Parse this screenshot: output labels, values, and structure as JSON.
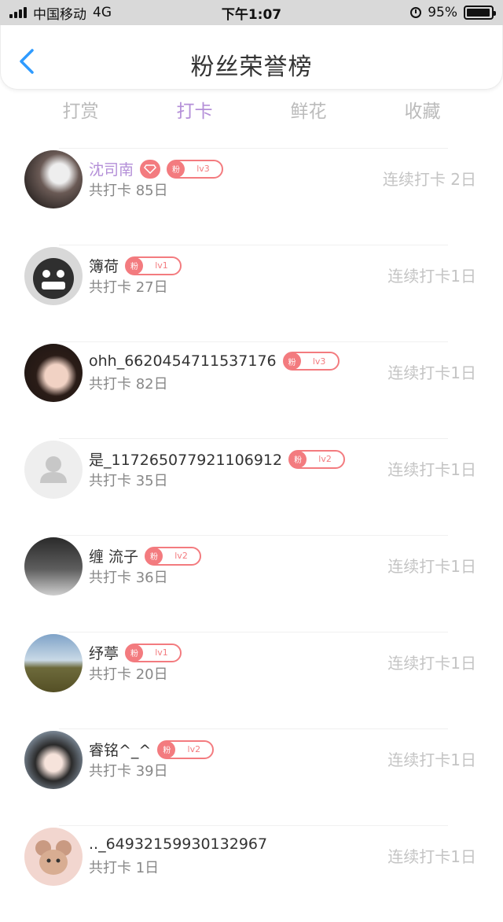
{
  "status_bar": {
    "carrier": "中国移动",
    "network": "4G",
    "time": "下午1:07",
    "battery_percent": "95%",
    "battery_level": 0.95
  },
  "nav": {
    "title": "粉丝荣誉榜",
    "back_icon": "chevron-left-icon"
  },
  "tabs": [
    {
      "label": "打赏",
      "active": false
    },
    {
      "label": "打卡",
      "active": true
    },
    {
      "label": "鲜花",
      "active": false
    },
    {
      "label": "收藏",
      "active": false
    }
  ],
  "colors": {
    "accent_purple": "#b48fd8",
    "badge_red": "#f37b7f",
    "muted_text": "#888888",
    "streak_text": "#c4c4c4"
  },
  "rows": [
    {
      "name": "沈司南",
      "vip": true,
      "badge_mark": "粉",
      "badge_level": "lv3",
      "total": "共打卡 85日",
      "streak": "连续打卡 2日"
    },
    {
      "name": "簿荷",
      "vip": false,
      "badge_mark": "粉",
      "badge_level": "lv1",
      "total": "共打卡 27日",
      "streak": "连续打卡1日"
    },
    {
      "name": "ohh_6620454711537176",
      "vip": false,
      "badge_mark": "粉",
      "badge_level": "lv3",
      "total": "共打卡 82日",
      "streak": "连续打卡1日"
    },
    {
      "name": "是_117265077921106912",
      "vip": false,
      "badge_mark": "粉",
      "badge_level": "lv2",
      "total": "共打卡 35日",
      "streak": "连续打卡1日"
    },
    {
      "name": "缠 流子",
      "vip": false,
      "badge_mark": "粉",
      "badge_level": "lv2",
      "total": "共打卡 36日",
      "streak": "连续打卡1日"
    },
    {
      "name": "纾葶",
      "vip": false,
      "badge_mark": "粉",
      "badge_level": "lv1",
      "total": "共打卡 20日",
      "streak": "连续打卡1日"
    },
    {
      "name": "睿铭^_^",
      "vip": false,
      "badge_mark": "粉",
      "badge_level": "lv2",
      "total": "共打卡 39日",
      "streak": "连续打卡1日"
    },
    {
      "name": ".._64932159930132967",
      "vip": false,
      "badge_mark": "",
      "badge_level": "",
      "total": "共打卡 1日",
      "streak": "连续打卡1日"
    }
  ]
}
